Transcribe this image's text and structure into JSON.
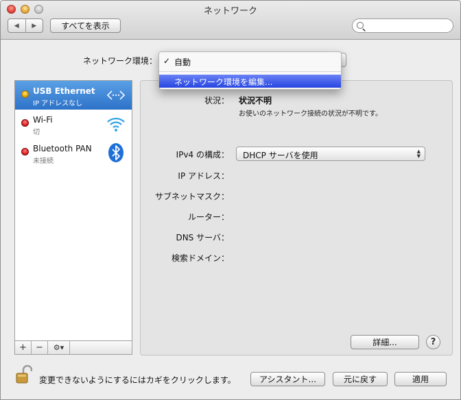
{
  "window": {
    "title": "ネットワーク"
  },
  "toolbar": {
    "back_glyph": "◀",
    "forward_glyph": "▶",
    "show_all_label": "すべてを表示",
    "search_value": ""
  },
  "location": {
    "label": "ネットワーク環境：",
    "menu": {
      "checked_glyph": "✓",
      "checked_item": "自動",
      "edit_item": "ネットワーク環境を編集..."
    }
  },
  "services": [
    {
      "name": "USB Ethernet",
      "status": "IP アドレスなし",
      "status_color": "#e6a800",
      "selected": true,
      "icon": "ethernet-arrows-icon"
    },
    {
      "name": "Wi-Fi",
      "status": "切",
      "status_color": "#d61c1c",
      "selected": false,
      "icon": "wifi-icon"
    },
    {
      "name": "Bluetooth PAN",
      "status": "未接続",
      "status_color": "#d61c1c",
      "selected": false,
      "icon": "bluetooth-icon"
    }
  ],
  "sidebar_tools": {
    "add": "+",
    "remove": "−",
    "gear": "⚙▾"
  },
  "detail": {
    "status_label": "状況：",
    "status_value": "状況不明",
    "status_desc": "お使いのネットワーク接続の状況が不明です。",
    "ipv4_label": "IPv4 の構成：",
    "ipv4_value": "DHCP サーバを使用",
    "ip_label": "IP アドレス：",
    "subnet_label": "サブネットマスク：",
    "router_label": "ルーター：",
    "dns_label": "DNS サーバ：",
    "search_domain_label": "検索ドメイン：",
    "advanced_button": "詳細...",
    "help_button": "?"
  },
  "footer": {
    "lock_text": "変更できないようにするにはカギをクリックします。",
    "assistant_button": "アシスタント...",
    "revert_button": "元に戻す",
    "apply_button": "適用"
  },
  "colors": {
    "selection": "#2d72c8",
    "menu_highlight": "#2645e0"
  }
}
